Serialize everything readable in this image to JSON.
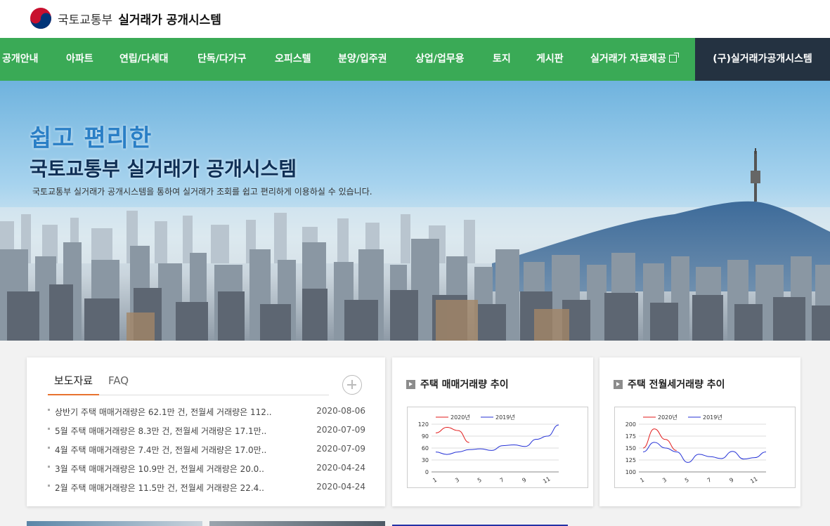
{
  "header": {
    "ministry": "국토교통부",
    "system_name": "실거래가 공개시스템"
  },
  "nav": {
    "items": [
      "공개안내",
      "아파트",
      "연립/다세대",
      "단독/다가구",
      "오피스텔",
      "분양/입주권",
      "상업/업무용",
      "토지",
      "게시판",
      "실거래가 자료제공"
    ],
    "legacy": "(구)실거래가공개시스템"
  },
  "hero": {
    "title1": "쉽고 편리한",
    "title2": "국토교통부 실거래가 공개시스템",
    "desc": "국토교통부 실거래가 공개시스템을 통하여 실거래가 조회를 쉽고 편리하게 이용하실 수 있습니다."
  },
  "news": {
    "tabs": [
      "보도자료",
      "FAQ"
    ],
    "items": [
      {
        "title": "상반기 주택 매매거래량은 62.1만 건, 전월세 거래량은 112..",
        "date": "2020-08-06"
      },
      {
        "title": "5월 주택 매매거래량은 8.3만 건, 전월세 거래량은 17.1만..",
        "date": "2020-07-09"
      },
      {
        "title": "4월 주택 매매거래량은 7.4만 건, 전월세 거래량은 17.0만..",
        "date": "2020-07-09"
      },
      {
        "title": "3월 주택 매매거래량은 10.9만 건, 전월세 거래량은 20.0..",
        "date": "2020-04-24"
      },
      {
        "title": "2월 주택 매매거래량은 11.5만 건, 전월세 거래량은 22.4..",
        "date": "2020-04-24"
      }
    ]
  },
  "colors": {
    "nav_green": "#3aaa56",
    "nav_dark": "#243241",
    "tab_accent": "#e8722f",
    "series_2020": "#e21b1b",
    "series_2019": "#2431d6"
  },
  "chart_data": [
    {
      "type": "line",
      "title": "주택 매매거래량 추이",
      "x": [
        1,
        2,
        3,
        4,
        5,
        6,
        7,
        8,
        9,
        10,
        11,
        12
      ],
      "xticks": [
        "1",
        "3",
        "5",
        "7",
        "9",
        "11"
      ],
      "yticks": [
        "120",
        "90",
        "60",
        "30",
        "0"
      ],
      "ylim": [
        0,
        120
      ],
      "grid": true,
      "legend": "top",
      "series": [
        {
          "name": "2020년",
          "values": [
            98,
            112,
            104,
            74
          ]
        },
        {
          "name": "2019년",
          "values": [
            50,
            44,
            50,
            56,
            58,
            54,
            66,
            68,
            64,
            82,
            90,
            118
          ]
        }
      ]
    },
    {
      "type": "line",
      "title": "주택 전월세거래량 추이",
      "x": [
        1,
        2,
        3,
        4,
        5,
        6,
        7,
        8,
        9,
        10,
        11,
        12
      ],
      "xticks": [
        "1",
        "3",
        "5",
        "7",
        "9",
        "11"
      ],
      "yticks": [
        "200",
        "175",
        "150",
        "125",
        "100"
      ],
      "ylim": [
        100,
        200
      ],
      "grid": true,
      "legend": "top",
      "series": [
        {
          "name": "2020년",
          "values": [
            150,
            190,
            168,
            145
          ]
        },
        {
          "name": "2019년",
          "values": [
            142,
            162,
            150,
            142,
            120,
            137,
            132,
            128,
            143,
            127,
            130,
            142
          ]
        }
      ]
    }
  ]
}
